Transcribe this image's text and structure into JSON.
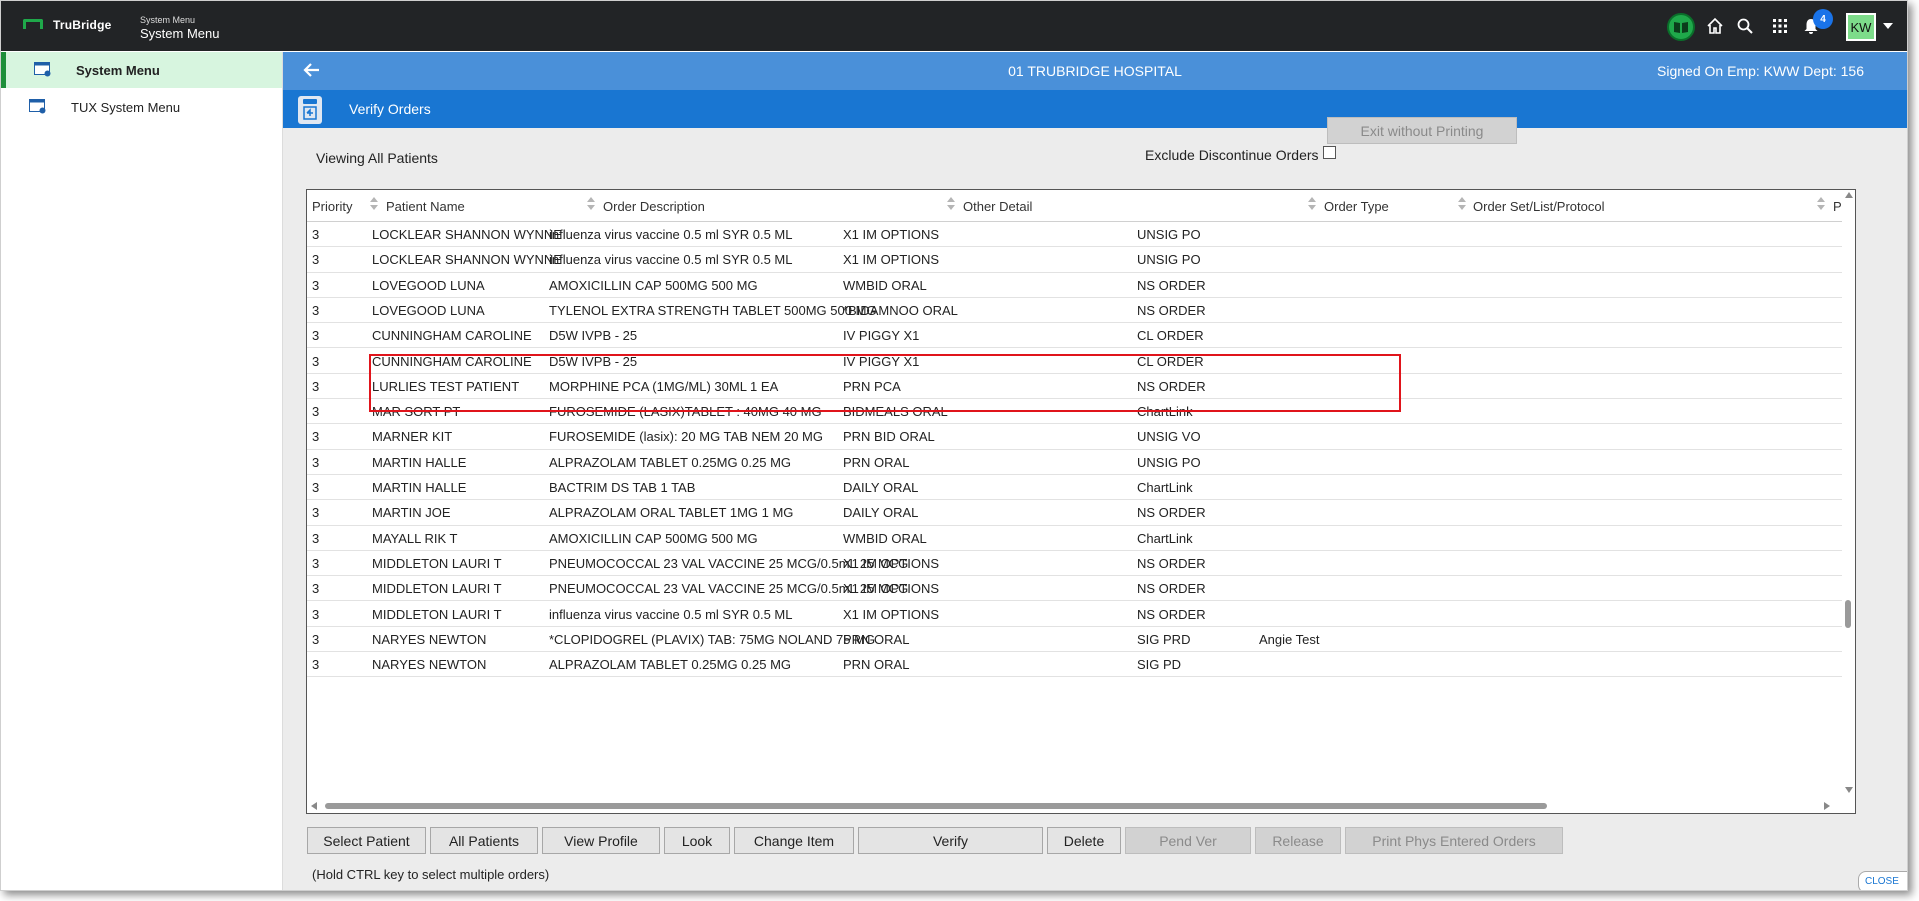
{
  "app": {
    "brand": "TruBridge",
    "context_small": "System Menu",
    "context_title": "System Menu",
    "notification_count": "4",
    "user_initials": "KW",
    "colors": {
      "topbar": "#222426",
      "brand_green": "#1fa84a",
      "header_blue": "#4a90d9",
      "verify_blue": "#1976d2",
      "highlight_red": "#e0141b"
    }
  },
  "sidebar": {
    "items": [
      {
        "label": "System Menu",
        "active": true
      },
      {
        "label": "TUX System Menu",
        "active": false
      }
    ]
  },
  "header": {
    "hospital": "01 TRUBRIDGE HOSPITAL",
    "signed_on": "Signed On Emp: KWW Dept: 156"
  },
  "page": {
    "title": "Verify Orders",
    "viewing": "Viewing All Patients",
    "exclude_label": "Exclude Discontinue Orders",
    "exclude_checked": false,
    "exit_button": "Exit without Printing",
    "hint": "(Hold CTRL key to select multiple orders)",
    "close_tab": "CLOSE"
  },
  "table": {
    "columns": [
      "Priority",
      "Patient Name",
      "Order Description",
      "Other Detail",
      "Order Type",
      "Order Set/List/Protocol",
      "P"
    ],
    "rows": [
      [
        "3",
        "LOCKLEAR SHANNON WYNNE",
        "influenza virus vaccine 0.5 ml SYR 0.5 ML",
        "X1 IM OPTIONS",
        "UNSIG PO",
        ""
      ],
      [
        "3",
        "LOCKLEAR SHANNON WYNNE",
        "influenza virus vaccine 0.5 ml SYR 0.5 ML",
        "X1 IM OPTIONS",
        "UNSIG PO",
        ""
      ],
      [
        "3",
        "LOVEGOOD LUNA",
        "AMOXICILLIN CAP 500MG 500 MG",
        "WMBID ORAL",
        "NS ORDER",
        ""
      ],
      [
        "3",
        "LOVEGOOD LUNA",
        "TYLENOL EXTRA STRENGTH TABLET 500MG 500 MG",
        "*BIDAMNOO ORAL",
        "NS ORDER",
        ""
      ],
      [
        "3",
        "CUNNINGHAM CAROLINE",
        "D5W IVPB - 25",
        "IV PIGGY X1",
        "CL ORDER",
        ""
      ],
      [
        "3",
        "CUNNINGHAM CAROLINE",
        "D5W IVPB - 25",
        "IV PIGGY X1",
        "CL ORDER",
        ""
      ],
      [
        "3",
        "LURLIES TEST PATIENT",
        "MORPHINE PCA (1MG/ML) 30ML 1 EA",
        "PRN PCA",
        "NS ORDER",
        ""
      ],
      [
        "3",
        "MAR SORT PT",
        "FUROSEMIDE (LASIX)TABLET : 40MG 40 MG",
        "BIDMEALS ORAL",
        "ChartLink",
        ""
      ],
      [
        "3",
        "MARNER KIT",
        "FUROSEMIDE (lasix): 20 MG TAB NEM 20 MG",
        "PRN BID ORAL",
        "UNSIG VO",
        ""
      ],
      [
        "3",
        "MARTIN HALLE",
        "ALPRAZOLAM TABLET 0.25MG 0.25 MG",
        "PRN ORAL",
        "UNSIG PO",
        ""
      ],
      [
        "3",
        "MARTIN HALLE",
        "BACTRIM DS TAB 1 TAB",
        "DAILY ORAL",
        "ChartLink",
        ""
      ],
      [
        "3",
        "MARTIN JOE",
        "ALPRAZOLAM ORAL TABLET 1MG 1 MG",
        "DAILY ORAL",
        "NS ORDER",
        ""
      ],
      [
        "3",
        "MAYALL RIK T",
        "AMOXICILLIN CAP 500MG 500 MG",
        "WMBID ORAL",
        "ChartLink",
        ""
      ],
      [
        "3",
        "MIDDLETON LAURI T",
        "PNEUMOCOCCAL 23 VAL VACCINE 25 MCG/0.5mL 25 MCG",
        "X1 IM OPTIONS",
        "NS ORDER",
        ""
      ],
      [
        "3",
        "MIDDLETON LAURI T",
        "PNEUMOCOCCAL 23 VAL VACCINE 25 MCG/0.5mL 25 MCG",
        "X1 IM OPTIONS",
        "NS ORDER",
        ""
      ],
      [
        "3",
        "MIDDLETON LAURI T",
        "influenza virus vaccine 0.5 ml SYR 0.5 ML",
        "X1 IM OPTIONS",
        "NS ORDER",
        ""
      ],
      [
        "3",
        "NARYES NEWTON",
        "*CLOPIDOGREL (PLAVIX) TAB: 75MG NOLAND 75 MG",
        "PRN ORAL",
        "SIG PRD",
        "Angie Test"
      ],
      [
        "3",
        "NARYES NEWTON",
        "ALPRAZOLAM TABLET 0.25MG 0.25 MG",
        "PRN ORAL",
        "SIG PD",
        ""
      ]
    ]
  },
  "buttons": [
    {
      "label": "Select Patient",
      "enabled": true
    },
    {
      "label": "All Patients",
      "enabled": true
    },
    {
      "label": "View Profile",
      "enabled": true
    },
    {
      "label": "Look",
      "enabled": true
    },
    {
      "label": "Change Item",
      "enabled": true
    },
    {
      "label": "Verify",
      "enabled": true
    },
    {
      "label": "Delete",
      "enabled": true
    },
    {
      "label": "Pend Ver",
      "enabled": false
    },
    {
      "label": "Release",
      "enabled": false
    },
    {
      "label": "Print Phys Entered Orders",
      "enabled": false
    }
  ]
}
